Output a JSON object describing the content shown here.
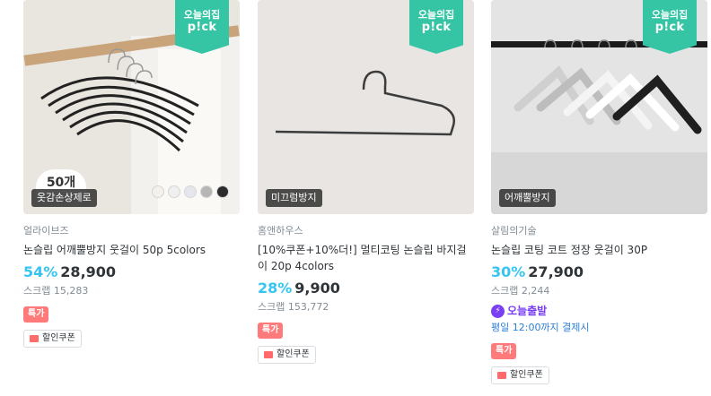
{
  "products": [
    {
      "pick_line1": "오늘의집",
      "pick_line2": "p!ck",
      "tag": "옷감손상제로",
      "count_badge": "50개",
      "swatch_colors": [
        "#f4f1ec",
        "#efefef",
        "#e6e7ee",
        "#b6b6b6",
        "#2c2c2c"
      ],
      "brand": "얼라이브즈",
      "title": "논슬립 어깨뿔방지 웃걸이 50p 5colors",
      "discount": "54%",
      "price": "28,900",
      "scrap": "스크랩 15,283",
      "special": "특가",
      "coupon": "할인쿠폰"
    },
    {
      "pick_line1": "오늘의집",
      "pick_line2": "p!ck",
      "tag": "미끄럼방지",
      "brand": "홈앤하우스",
      "title": "[10%쿠폰+10%더!] 멀티코팅 논슬립 바지걸이 20p 4colors",
      "discount": "28%",
      "price": "9,900",
      "scrap": "스크랩 153,772",
      "special": "특가",
      "coupon": "할인쿠폰"
    },
    {
      "pick_line1": "오늘의집",
      "pick_line2": "p!ck",
      "tag": "어깨뿔방지",
      "brand": "살림의기술",
      "title": "논슬립 코팅 코트 정장 웃걸이 30P",
      "discount": "30%",
      "price": "27,900",
      "scrap": "스크랩 2,244",
      "delivery_badge": "오늘출발",
      "delivery_icon": "lightning-icon",
      "deadline": "평일 12:00까지 결제시",
      "special": "특가",
      "coupon": "할인쿠폰"
    }
  ],
  "colors": {
    "accent_pick": "#35c5a4",
    "discount": "#35c5f0",
    "special_badge": "#ff7a7a",
    "delivery": "#7a3ff2",
    "deadline": "#2d7fd8"
  }
}
